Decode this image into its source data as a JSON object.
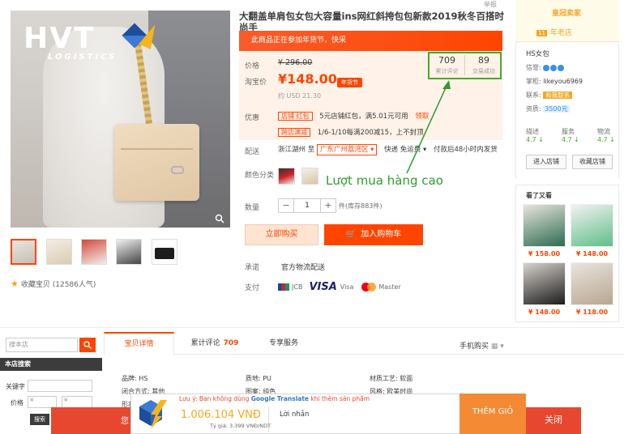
{
  "product": {
    "title": "大翻盖单肩包女包大容量ins网红斜挎包包新款2019秋冬百搭时尚手",
    "corner_link": "举报",
    "promo_text": "此商品正在参加年货节，快采",
    "price_label": "价格",
    "original_price": "¥ 296.00",
    "taobao_price_label": "淘宝价",
    "taobao_price": "¥148.00",
    "year_tag": "年货节",
    "usd_price": "约 USD 21.30",
    "reviews_count": "709",
    "reviews_label": "累计评论",
    "sales_count": "89",
    "sales_label": "交易成功",
    "promo_label": "优惠",
    "coupon_tag_1": "店铺 红包",
    "coupon_text_1": "5元店铺红包，满5.01元可用",
    "coupon_link": "领取",
    "coupon_tag_2": "跨店满减",
    "coupon_text_2": "1/6-1/10每满200减15，上不封顶",
    "delivery_label": "配送",
    "delivery_from": "浙江湖州 至",
    "delivery_to": "广东广州荔湾区 ▾",
    "delivery_express": "快递 免运费 ▾",
    "delivery_time": "付款后48小时内发货",
    "color_label": "颜色分类",
    "qty_label": "数量",
    "qty_minus": "−",
    "qty_value": "1",
    "qty_plus": "+",
    "stock": "件(库存883件)",
    "buy_now": "立即购买",
    "add_to_cart": "加入购物车",
    "promise_label": "承诺",
    "promise_text": "官方物流配送",
    "pay_label": "支付",
    "pay_jcb": "JCB",
    "pay_visa_logo": "VISA",
    "pay_visa": "Visa",
    "pay_mastercard": "Master",
    "favorite": "收藏宝贝 (12586人气)"
  },
  "annotation": {
    "text": "Lượt mua hàng cao",
    "color": "#2e9c2e"
  },
  "logo": {
    "brand": "HVT",
    "sub": "LOGISTICS"
  },
  "shop": {
    "gold_title": "皇冠卖家",
    "years_badge": "11",
    "years_text": "年老店",
    "name": "HS女包",
    "credit_label": "信誉:",
    "keeper_label": "掌柜:",
    "keeper_value": "likeyou6969",
    "contact_label": "联系:",
    "contact_btn": "和我联系",
    "quals_label": "资质:",
    "quals_value": "3500元",
    "scores": [
      {
        "label": "描述",
        "value": "4.7 ↓"
      },
      {
        "label": "服务",
        "value": "4.7 ↓"
      },
      {
        "label": "物流",
        "value": "4.7 ↓"
      }
    ],
    "enter_shop": "进入店铺",
    "fav_shop": "收藏店铺"
  },
  "also_viewed": {
    "title": "看了又看",
    "prices": [
      "¥ 158.00",
      "¥ 148.00",
      "¥ 148.00",
      "¥ 118.00"
    ]
  },
  "sidebar": {
    "search_placeholder": "搜本店",
    "search_icon": "search-icon",
    "store_search_title": "本店搜索",
    "keyword_label": "关键字",
    "price_label": "价格",
    "price_min": "¥",
    "price_max": "¥",
    "go": "搜索"
  },
  "tabs": [
    {
      "label": "宝贝详情"
    },
    {
      "label": "累计评论",
      "count": "709"
    },
    {
      "label": "专享服务"
    }
  ],
  "mobile_buy": "手机购买",
  "attrs": {
    "brand": "品牌: HS",
    "material": "质地: PU",
    "craft": "材质工艺: 软面",
    "closure": "闭合方式: 其他",
    "pattern": "图案: 纯色",
    "style": "风格: 欧美时尚",
    "shape": "形状"
  },
  "overlay": {
    "left_text": "您",
    "note_prefix": "Lưu ý: Bạn không dùng ",
    "note_gt": "Google Translate",
    "note_suffix": " khi thêm sản phẩm",
    "price": "1.006.104 VNĐ",
    "rate": "Tỷ giá: 3.399 VNĐ/NDT",
    "message": "Lời nhắn",
    "add_btn": "THÊM GIỎ",
    "close_btn": "关闭"
  }
}
